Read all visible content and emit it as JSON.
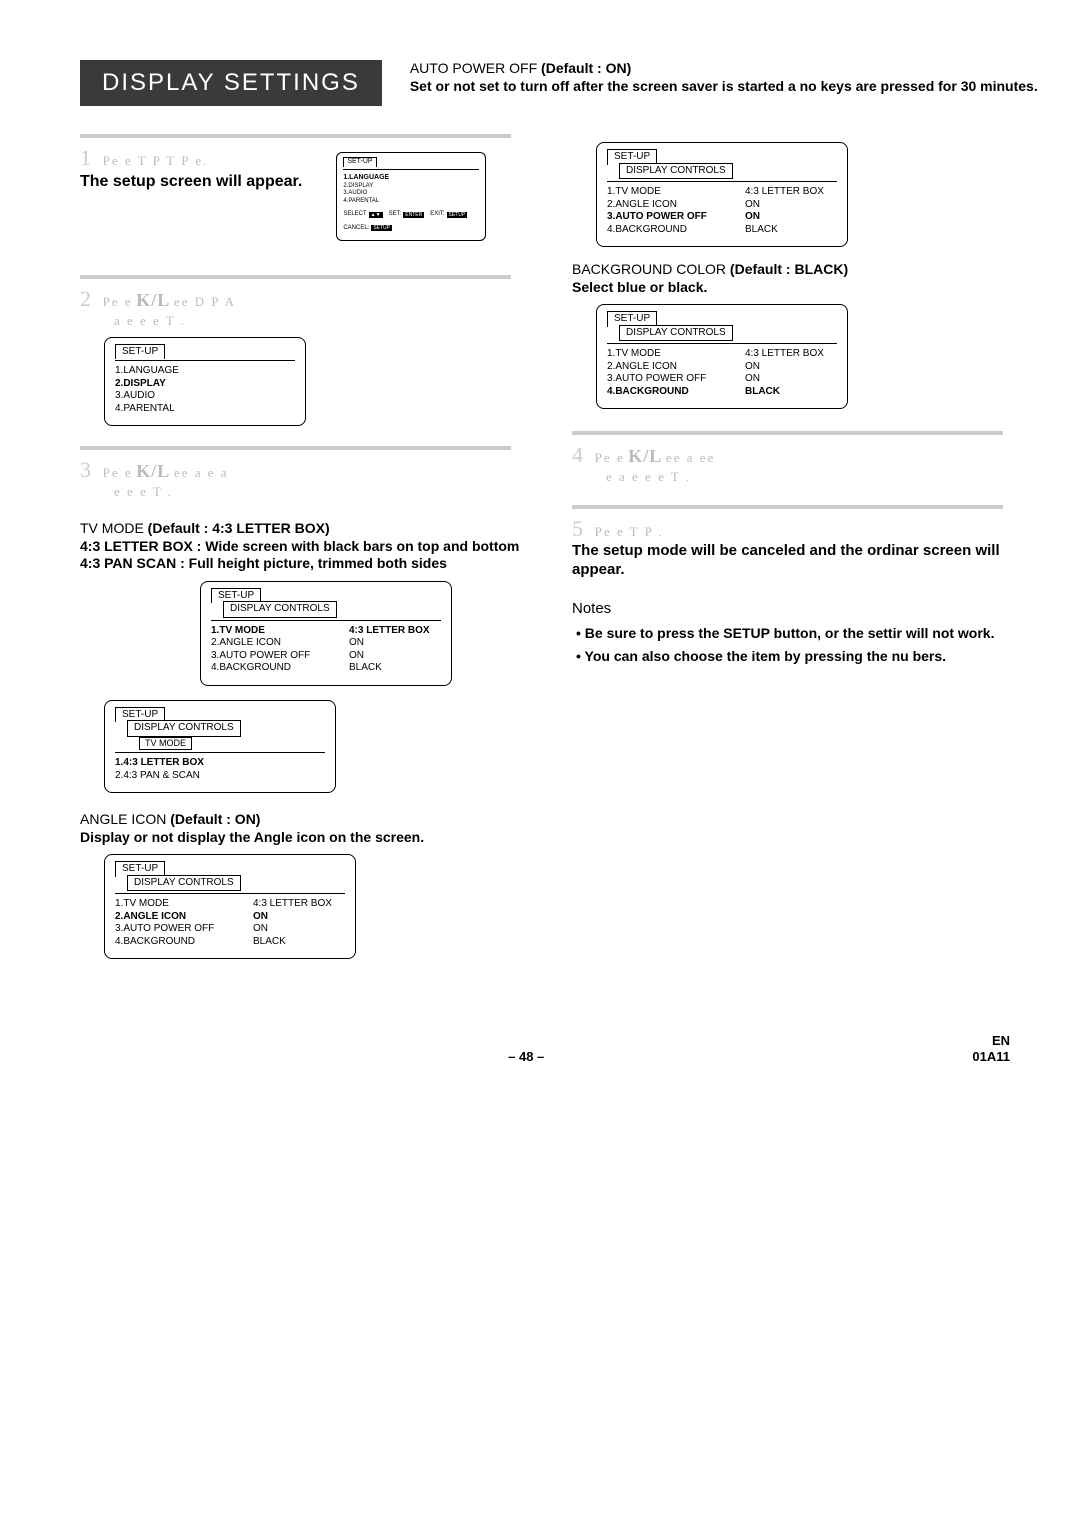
{
  "header": {
    "title": "DISPLAY SETTINGS",
    "auto_label": "AUTO POWER OFF ",
    "auto_default": "(Default : ON)",
    "auto_desc": "Set or not set to turn off after the screen saver is started a no keys are pressed for 30 minutes."
  },
  "step1": {
    "text1": "Pe  e    T P     T P  e.",
    "bold": "The setup screen will appear."
  },
  "step2": {
    "text1": "Pe  e",
    "kl": "K/L",
    "text2": "ee   D   P A",
    "text3": "a   e e e    T    ."
  },
  "step3": {
    "text1": "Pe  e",
    "kl": "K/L",
    "text2": "ee  a e  a",
    "text3": "e e e   T    ."
  },
  "step4": {
    "text1": "Pe  e",
    "kl": "K/L",
    "text2": "ee   a    ee",
    "text3": "e  a   e e e   T    ."
  },
  "step5": {
    "text1": "Pe  e    T P   .",
    "bold1": "The setup mode will be canceled and the ordinar screen will appear."
  },
  "tvmode": {
    "title": "TV MODE ",
    "default": "(Default : 4:3 LETTER BOX)",
    "l1": "4:3 LETTER BOX : Wide screen with black bars on top and bottom",
    "l2": "4:3 PAN     SCAN : Full height picture, trimmed both sides"
  },
  "angle": {
    "title": "ANGLE ICON ",
    "default": "(Default : ON)",
    "desc": "Display or not display the Angle icon on the screen."
  },
  "bg": {
    "title": "BACKGROUND COLOR ",
    "default": "(Default : BLACK)",
    "desc": "Select blue or black."
  },
  "notes": {
    "head": "Notes",
    "n1": "Be sure to press the SETUP button, or the settir will not work.",
    "n2": "You can also choose the item by pressing the nu bers."
  },
  "menu_labels": {
    "setup": "SET-UP",
    "display_controls": "DISPLAY CONTROLS",
    "tv_mode_tab": "TV MODE",
    "items_main": [
      {
        "k": "1.LANGUAGE",
        "v": ""
      },
      {
        "k": "2.DISPLAY",
        "v": ""
      },
      {
        "k": "3.AUDIO",
        "v": ""
      },
      {
        "k": "4.PARENTAL",
        "v": ""
      }
    ],
    "items_dc": [
      {
        "k": "1.TV MODE",
        "v": "4:3 LETTER BOX"
      },
      {
        "k": "2.ANGLE ICON",
        "v": "ON"
      },
      {
        "k": "3.AUTO POWER OFF",
        "v": "ON"
      },
      {
        "k": "4.BACKGROUND",
        "v": "BLACK"
      }
    ],
    "items_tvmode": [
      {
        "k": "1.4:3 LETTER BOX",
        "v": ""
      },
      {
        "k": "2.4:3 PAN & SCAN",
        "v": ""
      }
    ],
    "foot_select": "SELECT",
    "foot_set": "SET:",
    "foot_exit": "EXIT:",
    "foot_cancel": "CANCEL:",
    "foot_enter": "ENTER",
    "foot_setup": "SETUP"
  },
  "footer": {
    "page": "– 48 –",
    "en": "EN",
    "code": "01A11"
  }
}
